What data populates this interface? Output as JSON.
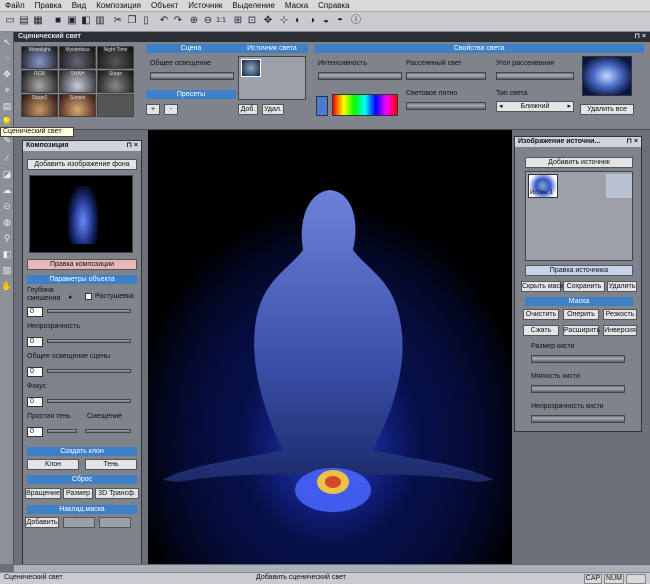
{
  "menu": [
    "Файл",
    "Правка",
    "Вид",
    "Композиция",
    "Объект",
    "Источник",
    "Выделение",
    "Маска",
    "Справка"
  ],
  "toolbar": {
    "zoom": "1:1"
  },
  "tooltip": "Сценический свет",
  "light_panel": {
    "title": "Сценический свет",
    "presets": [
      "Moonlight",
      "Mysterious",
      "Night Time",
      "RGB",
      "SHAH",
      "Stage",
      "Stage2",
      "Sunset",
      ""
    ],
    "scene_header": "Сцена",
    "ambient_label": "Общее освещение",
    "presets_header": "Пресеты",
    "plus": "+",
    "minus": "-",
    "sources_header": "Источник света",
    "add_btn": "Доб.",
    "remove_btn": "Удал.",
    "props_header": "Свойства света",
    "intensity": "Интенсивность",
    "diffuse": "Рассеянный свет",
    "scatter_angle": "Угол рассеивания",
    "light_spot": "Световое пятно",
    "light_type": "Тип света",
    "light_type_value": "Ближний",
    "remove_all": "Удалить все"
  },
  "composition": {
    "title": "Композиция",
    "add_bg": "Добавить изображение фона",
    "edit_comp": "Правка композиции",
    "obj_params": "Параметры объекта",
    "blend_depth": "Глубина смешения",
    "feather": "Растушевка",
    "blend_value": "0",
    "opacity": "Непрозрачность",
    "opacity_value": "0",
    "scene_light": "Общее освещение сцены",
    "scene_light_value": "0",
    "focus": "Фокус",
    "focus_value": "0",
    "simple_shadow": "Простая тень",
    "offset": "Смещение",
    "shadow_value": "0",
    "create_clone": "Создать клон",
    "clone": "Клон",
    "shadow": "Тень",
    "reset": "Сброс",
    "rotation": "Вращение",
    "size": "Размер",
    "transform3d": "3D Трансф.",
    "overlay_mask": "Наклад.маска",
    "add": "Добавить"
  },
  "source_image": {
    "title": "Изображение источни...",
    "add_source": "Добавить источник",
    "thumb_label": "Источ. 1",
    "edit_source": "Правка источника",
    "hide_mask": "Скрыть маску",
    "save": "Сохранить",
    "delete": "Удалить",
    "mask_header": "Маска",
    "clear": "Очистить",
    "trim": "Оперить",
    "sharpen": "Резкость",
    "shrink": "Сжать",
    "expand": "Расширить",
    "invert": "Инверсия",
    "brush_size": "Размер кисти",
    "brush_softness": "Мягкость кисти",
    "brush_opacity": "Непрозрачность кисти"
  },
  "status": {
    "left": "Сценический свет",
    "middle": "Добавить сценический свет",
    "cap": "CAP",
    "num": "NUM"
  },
  "colors": {
    "accent": "#3d80c8",
    "panel": "#7e838c",
    "canvas": "#000000"
  }
}
